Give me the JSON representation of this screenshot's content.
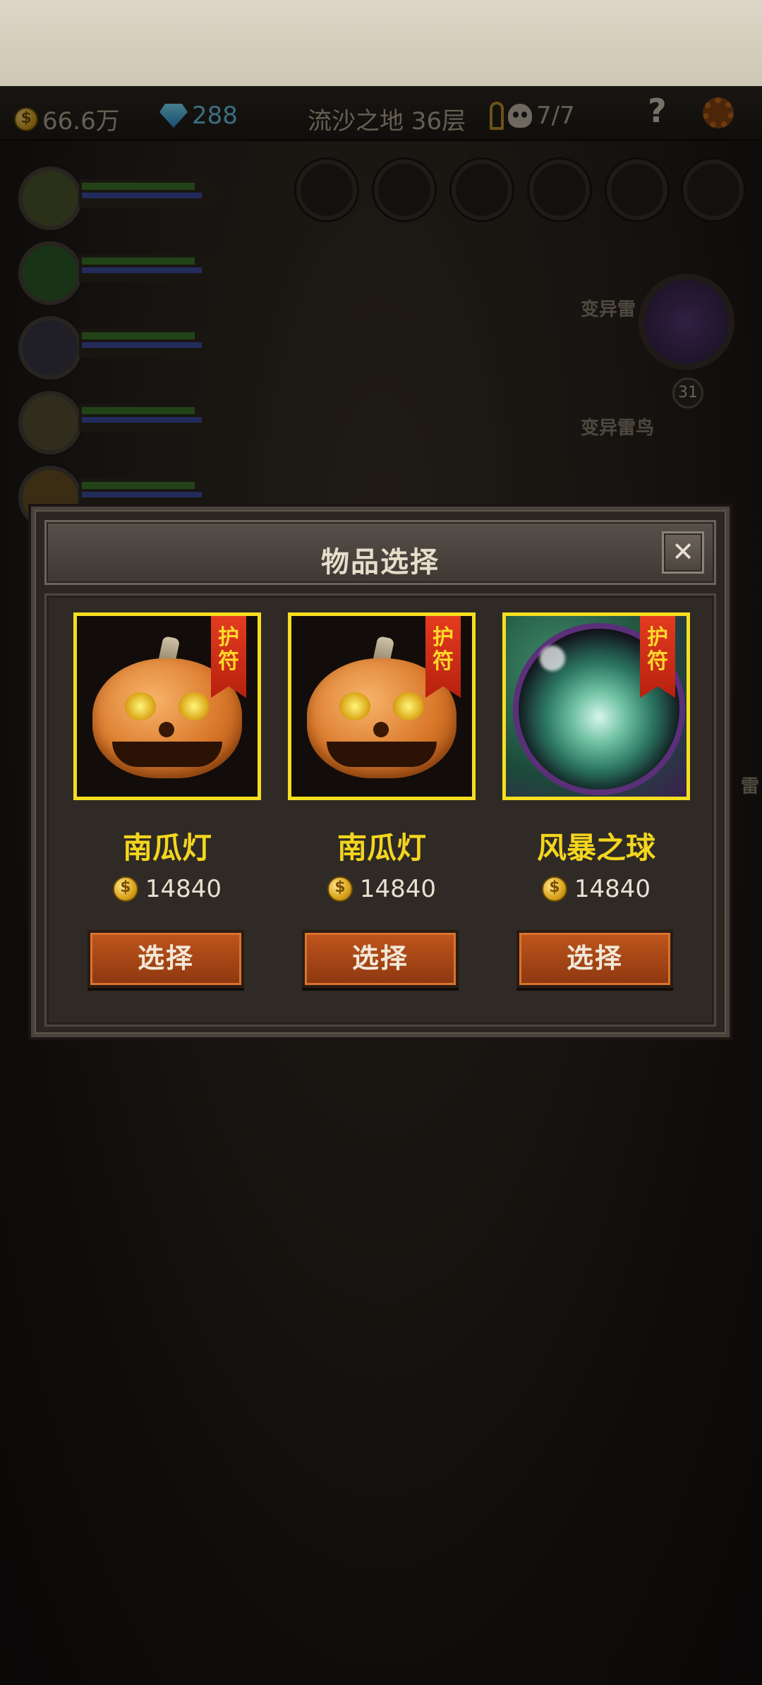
{
  "topbar": {
    "gold": "66.6万",
    "gems": "288",
    "stage": "流沙之地 36层",
    "kills": "7/7",
    "help": "?"
  },
  "enemies": {
    "label1": "变异雷",
    "label2": "变异雷鸟",
    "label3": "雷",
    "boss_level": "31"
  },
  "modal": {
    "title": "物品选择",
    "close": "✕",
    "items": [
      {
        "name": "南瓜灯",
        "tag": "护符",
        "price": "14840",
        "button": "选择"
      },
      {
        "name": "南瓜灯",
        "tag": "护符",
        "price": "14840",
        "button": "选择"
      },
      {
        "name": "风暴之球",
        "tag": "护符",
        "price": "14840",
        "button": "选择"
      }
    ]
  },
  "colors": {
    "accent_yellow": "#f5de1f",
    "button_orange": "#b44a18",
    "ribbon_red": "#d32f17"
  }
}
